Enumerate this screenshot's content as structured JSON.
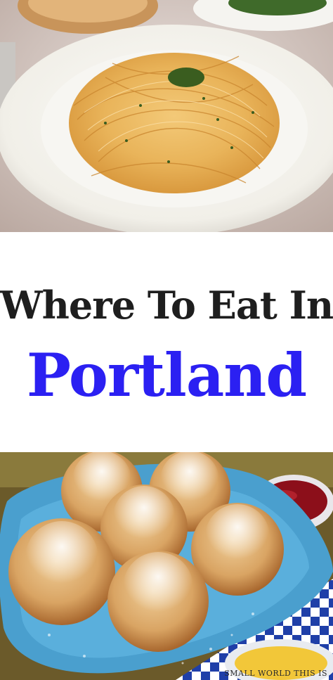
{
  "title": {
    "line1": "Where To Eat In",
    "line2": "Portland",
    "line2_color": "#2b20f2"
  },
  "top_photo": {
    "subject": "plate of spaghetti with herbs"
  },
  "bottom_photo": {
    "subject": "powdered sugar pastry puffs with jam on blue plate"
  },
  "watermark": {
    "text": "Small World This Is"
  }
}
